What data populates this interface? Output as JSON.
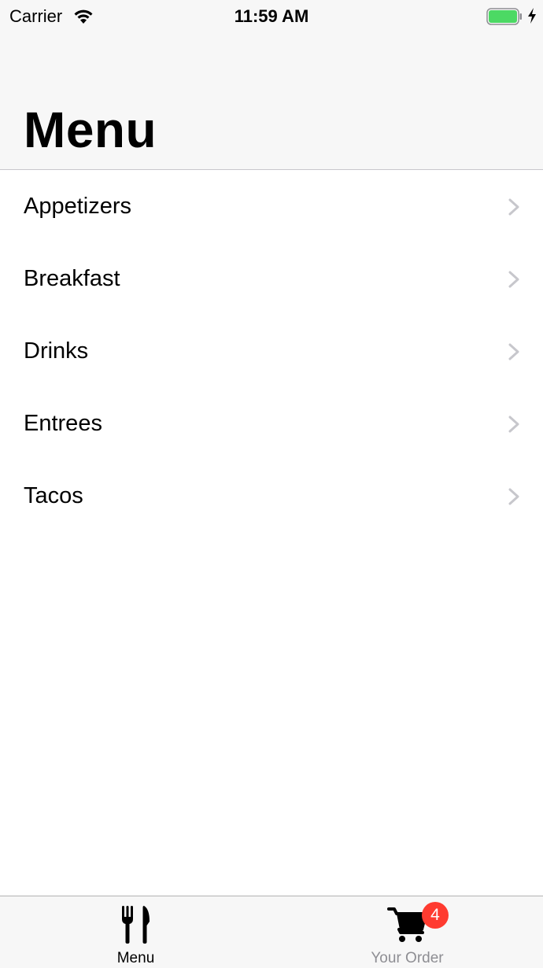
{
  "status_bar": {
    "carrier": "Carrier",
    "time": "11:59 AM",
    "icons": [
      "wifi-icon",
      "battery-icon",
      "charging-bolt-icon"
    ],
    "battery_color": "#4cd964"
  },
  "header": {
    "title": "Menu"
  },
  "menu": {
    "items": [
      {
        "label": "Appetizers"
      },
      {
        "label": "Breakfast"
      },
      {
        "label": "Drinks"
      },
      {
        "label": "Entrees"
      },
      {
        "label": "Tacos"
      }
    ],
    "disclosure_icon": "chevron-right-icon"
  },
  "tab_bar": {
    "tabs": [
      {
        "label": "Menu",
        "icon": "fork-knife-icon",
        "selected": true
      },
      {
        "label": "Your Order",
        "icon": "cart-icon",
        "badge": "4",
        "selected": false
      }
    ],
    "badge_color": "#ff3b30",
    "selected_color": "#000000",
    "unselected_color": "#8e8e93"
  }
}
